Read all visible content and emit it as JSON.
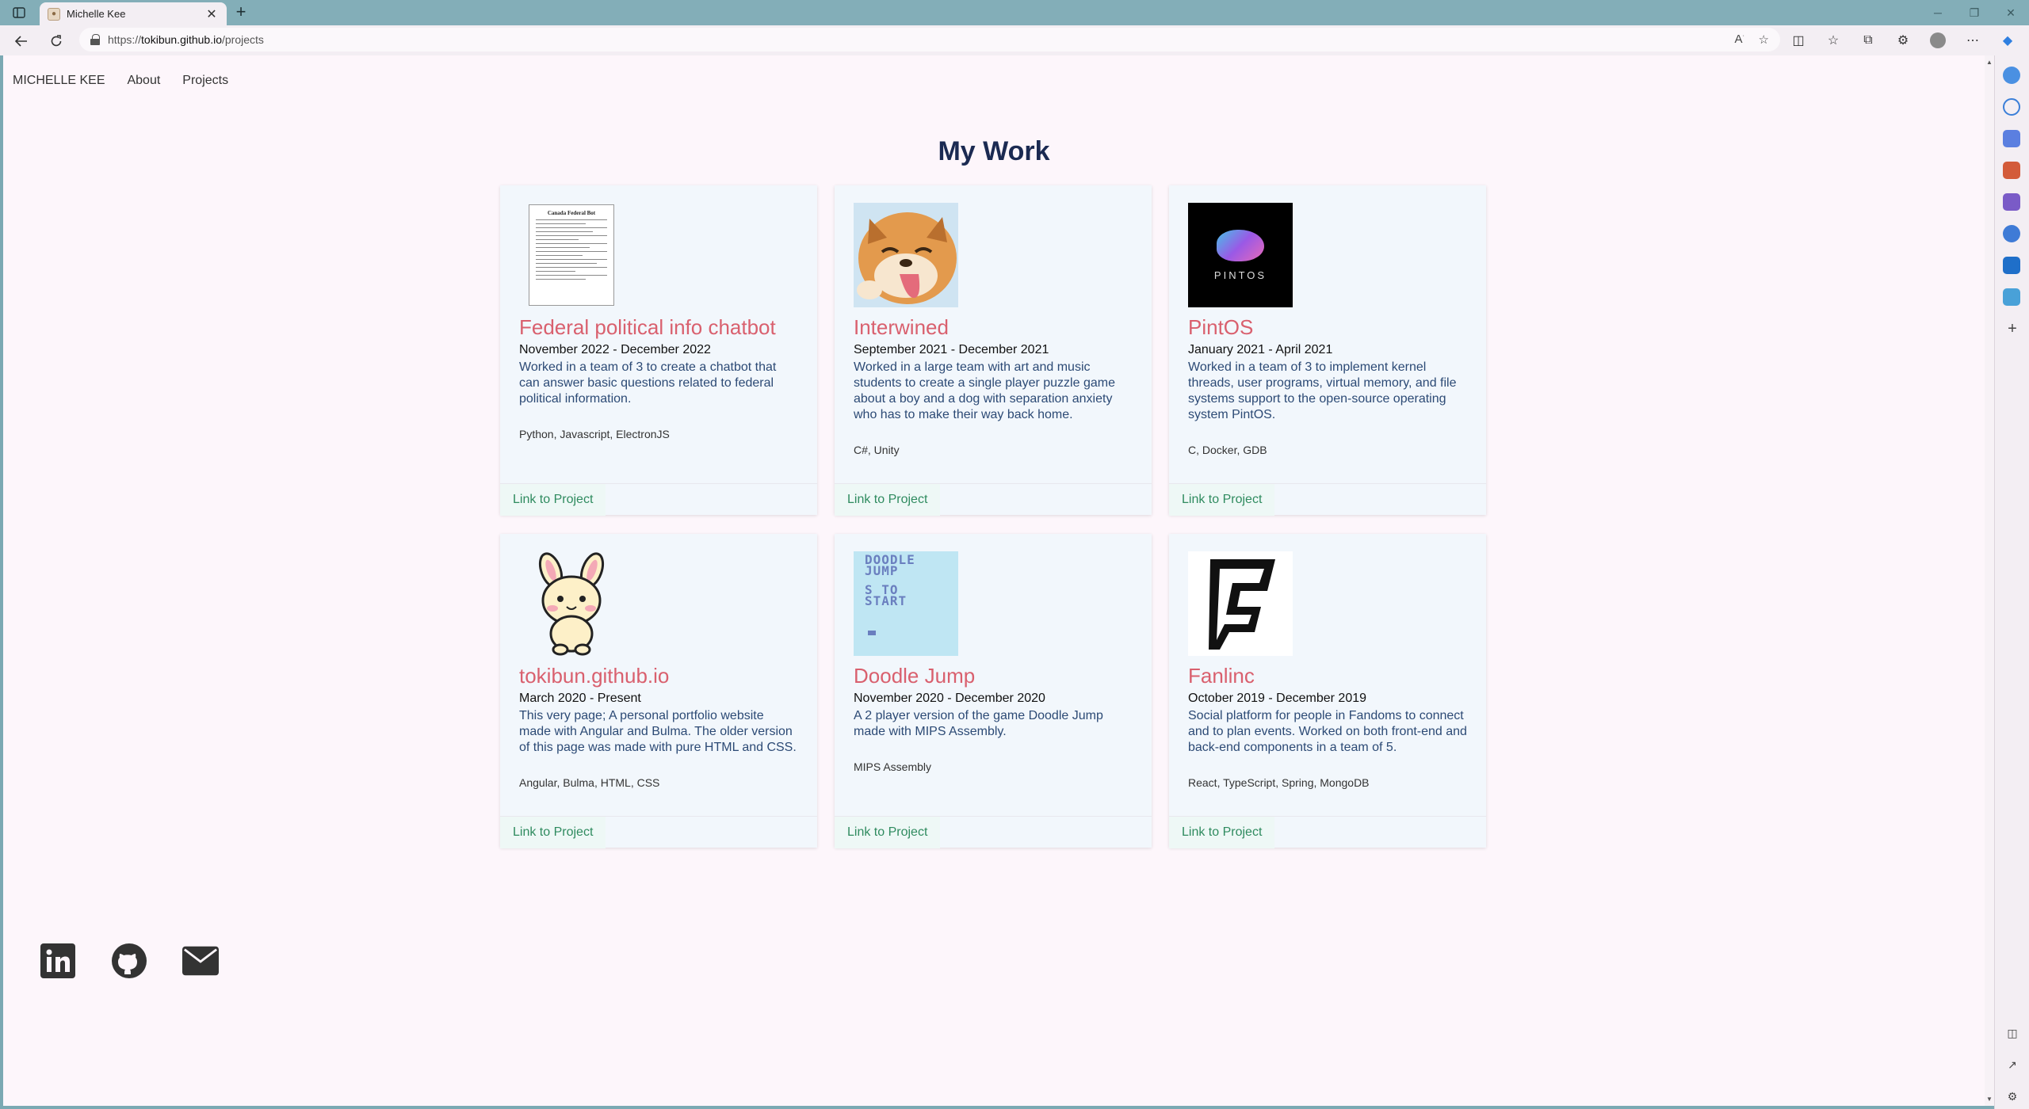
{
  "browser": {
    "tab_title": "Michelle Kee",
    "url_prefix": "https://",
    "url_domain": "tokibun.github.io",
    "url_path": "/projects"
  },
  "nav": {
    "brand": "MICHELLE KEE",
    "about": "About",
    "projects": "Projects"
  },
  "page": {
    "title": "My Work"
  },
  "projects": [
    {
      "title": "Federal political info chatbot",
      "dates": "November 2022 - December 2022",
      "description": "Worked in a team of 3 to create a chatbot that can answer basic questions related to federal political information.",
      "tech": "Python, Javascript, ElectronJS",
      "link": "Link to Project",
      "thumb_text": "Canada Federal Bot"
    },
    {
      "title": "Interwined",
      "dates": "September 2021 - December 2021",
      "description": "Worked in a large team with art and music students to create a single player puzzle game about a boy and a dog with separation anxiety who has to make their way back home.",
      "tech": "C#, Unity",
      "link": "Link to Project"
    },
    {
      "title": "PintOS",
      "dates": "January 2021 - April 2021",
      "description": "Worked in a team of 3 to implement kernel threads, user programs, virtual memory, and file systems support to the open-source operating system PintOS.",
      "tech": "C, Docker, GDB",
      "link": "Link to Project",
      "thumb_text": "PINTOS"
    },
    {
      "title": "tokibun.github.io",
      "dates": "March 2020 - Present",
      "description": "This very page; A personal portfolio website made with Angular and Bulma. The older version of this page was made with pure HTML and CSS.",
      "tech": "Angular, Bulma, HTML, CSS",
      "link": "Link to Project"
    },
    {
      "title": "Doodle Jump",
      "dates": "November 2020 - December 2020",
      "description": "A 2 player version of the game Doodle Jump made with MIPS Assembly.",
      "tech": "MIPS Assembly",
      "link": "Link to Project",
      "thumb_text_1": "DOODLE JUMP",
      "thumb_text_2": "S TO START"
    },
    {
      "title": "Fanlinc",
      "dates": "October 2019 - December 2019",
      "description": "Social platform for people in Fandoms to connect and to plan events. Worked on both front-end and back-end components in a team of 5.",
      "tech": "React, TypeScript, Spring, MongoDB",
      "link": "Link to Project"
    }
  ],
  "social": [
    "linkedin-icon",
    "github-icon",
    "mail-icon"
  ],
  "colors": {
    "title": "#1b2a52",
    "card_title": "#d9606e",
    "description": "#2c4a75",
    "link": "#2f8b5f",
    "page_bg": "#fdf6fb",
    "card_bg": "#f2f7fc"
  }
}
